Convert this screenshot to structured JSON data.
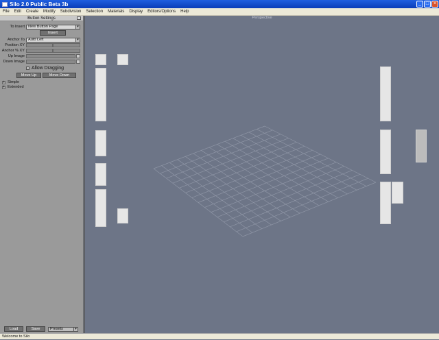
{
  "window": {
    "title": "Silo 2.0 Public Beta 3b"
  },
  "menu": [
    "File",
    "Edit",
    "Create",
    "Modify",
    "Subdivision",
    "Selection",
    "Materials",
    "Display",
    "Editors/Options",
    "Help"
  ],
  "panel": {
    "title": "Button Settings",
    "to_insert_label": "To Insert",
    "to_insert_value": "New Button Page",
    "insert_label": "Insert",
    "anchor_to_label": "Anchor To",
    "anchor_to_value": "Auto Left",
    "position_label": "Position XY",
    "anchor_pct_label": "Anchor % XY",
    "up_image_label": "Up Image",
    "down_image_label": "Down Image",
    "allow_dragging_label": "Allow Dragging",
    "move_up_label": "Move Up",
    "move_down_label": "Move Down",
    "tree": [
      "Simple",
      "Extended"
    ],
    "load_label": "Load",
    "save_label": "Save",
    "presets_value": "Presets"
  },
  "viewport": {
    "label": "Perspective"
  },
  "status": "Welcome to Silo"
}
